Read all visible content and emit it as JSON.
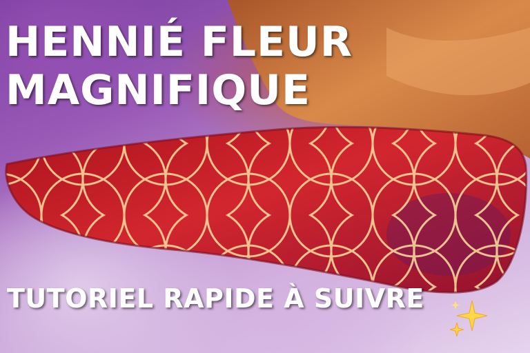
{
  "title_line_1": "HENNIÉ FLEUR",
  "title_line_2": "MAGNIFIQUE",
  "subtitle": "TUTORIEL RAPIDE À SUIVRE",
  "sparkles_icon": "sparkles-icon",
  "colors": {
    "text": "#ffffff",
    "henna": "#c41e28",
    "pattern_lines": "#f5d49a",
    "skin": "#c8743a",
    "background": "#b48ccc"
  }
}
